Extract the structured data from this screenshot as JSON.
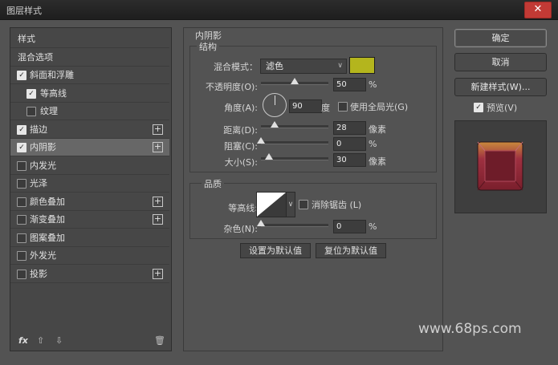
{
  "window": {
    "title": "图层样式",
    "close_glyph": "✕"
  },
  "left_list": [
    {
      "label": "样式",
      "kind": "header"
    },
    {
      "label": "混合选项",
      "kind": "header"
    },
    {
      "label": "斜面和浮雕",
      "checked": true,
      "indent": 1,
      "plus": false
    },
    {
      "label": "等高线",
      "checked": true,
      "indent": 2,
      "plus": false
    },
    {
      "label": "纹理",
      "checked": false,
      "indent": 2,
      "plus": false
    },
    {
      "label": "描边",
      "checked": true,
      "indent": 1,
      "plus": true
    },
    {
      "label": "内阴影",
      "checked": true,
      "indent": 1,
      "plus": true,
      "selected": true
    },
    {
      "label": "内发光",
      "checked": false,
      "indent": 1,
      "plus": false
    },
    {
      "label": "光泽",
      "checked": false,
      "indent": 1,
      "plus": false
    },
    {
      "label": "颜色叠加",
      "checked": false,
      "indent": 1,
      "plus": true
    },
    {
      "label": "渐变叠加",
      "checked": false,
      "indent": 1,
      "plus": true
    },
    {
      "label": "图案叠加",
      "checked": false,
      "indent": 1,
      "plus": false
    },
    {
      "label": "外发光",
      "checked": false,
      "indent": 1,
      "plus": false
    },
    {
      "label": "投影",
      "checked": false,
      "indent": 1,
      "plus": true
    }
  ],
  "left_footer": {
    "fx": "fx",
    "up_icon": "arrow-up-icon",
    "down_icon": "arrow-down-icon",
    "trash_icon": "trash-icon"
  },
  "inner_shadow": {
    "section_title": "内阴影",
    "structure": {
      "title": "结构",
      "blend_mode_label": "混合模式：",
      "blend_mode_value": "滤色",
      "color": "#b4b51d",
      "opacity_label": "不透明度(O):",
      "opacity_value": "50",
      "opacity_unit": "%",
      "opacity_fraction": 0.5,
      "angle_label": "角度(A):",
      "angle_value": "90",
      "angle_unit": "度",
      "global_light_label": "使用全局光(G)",
      "global_light_checked": false,
      "distance_label": "距离(D):",
      "distance_value": "28",
      "distance_unit": "像素",
      "distance_fraction": 0.2,
      "choke_label": "阻塞(C):",
      "choke_value": "0",
      "choke_unit": "%",
      "choke_fraction": 0,
      "size_label": "大小(S):",
      "size_value": "30",
      "size_unit": "像素",
      "size_fraction": 0.12
    },
    "quality": {
      "title": "品质",
      "contour_label": "等高线:",
      "antialias_label": "消除锯齿 (L)",
      "antialias_checked": false,
      "noise_label": "杂色(N):",
      "noise_value": "0",
      "noise_unit": "%",
      "noise_fraction": 0
    },
    "set_default_label": "设置为默认值",
    "reset_default_label": "复位为默认值"
  },
  "right_buttons": {
    "ok": "确定",
    "cancel": "取消",
    "new_style": "新建样式(W)...",
    "preview_label": "预览(V)",
    "preview_checked": true
  },
  "watermark": "www.68ps.com"
}
